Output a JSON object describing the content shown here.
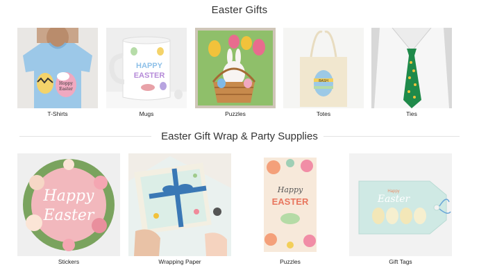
{
  "sections": [
    {
      "title": "Easter Gifts",
      "items": [
        {
          "label": "T-Shirts"
        },
        {
          "label": "Mugs"
        },
        {
          "label": "Puzzles"
        },
        {
          "label": "Totes"
        },
        {
          "label": "Ties"
        }
      ]
    },
    {
      "title": "Easter Gift Wrap & Party Supplies",
      "items": [
        {
          "label": "Stickers"
        },
        {
          "label": "Wrapping Paper"
        },
        {
          "label": "Puzzles"
        },
        {
          "label": "Gift Tags"
        }
      ]
    }
  ],
  "artwork": {
    "shirt_text": [
      "Hoppy",
      "Easter"
    ],
    "mug_text": [
      "HAPPY",
      "EASTER"
    ],
    "tote_text": "BASH",
    "sticker_text": [
      "Happy",
      "Easter"
    ],
    "bag_text": [
      "Happy",
      "EASTER"
    ],
    "tag_text": [
      "Happy",
      "Easter"
    ]
  },
  "colors": {
    "text": "#222222",
    "rule": "#e2e2e2",
    "thumb_bg": "#f2f2f2",
    "shirt_blue": "#9cc8e8",
    "sticker_pink": "#f2b8bd",
    "tag_mint": "#cfe9e4",
    "tie_green": "#1f8a4a"
  }
}
